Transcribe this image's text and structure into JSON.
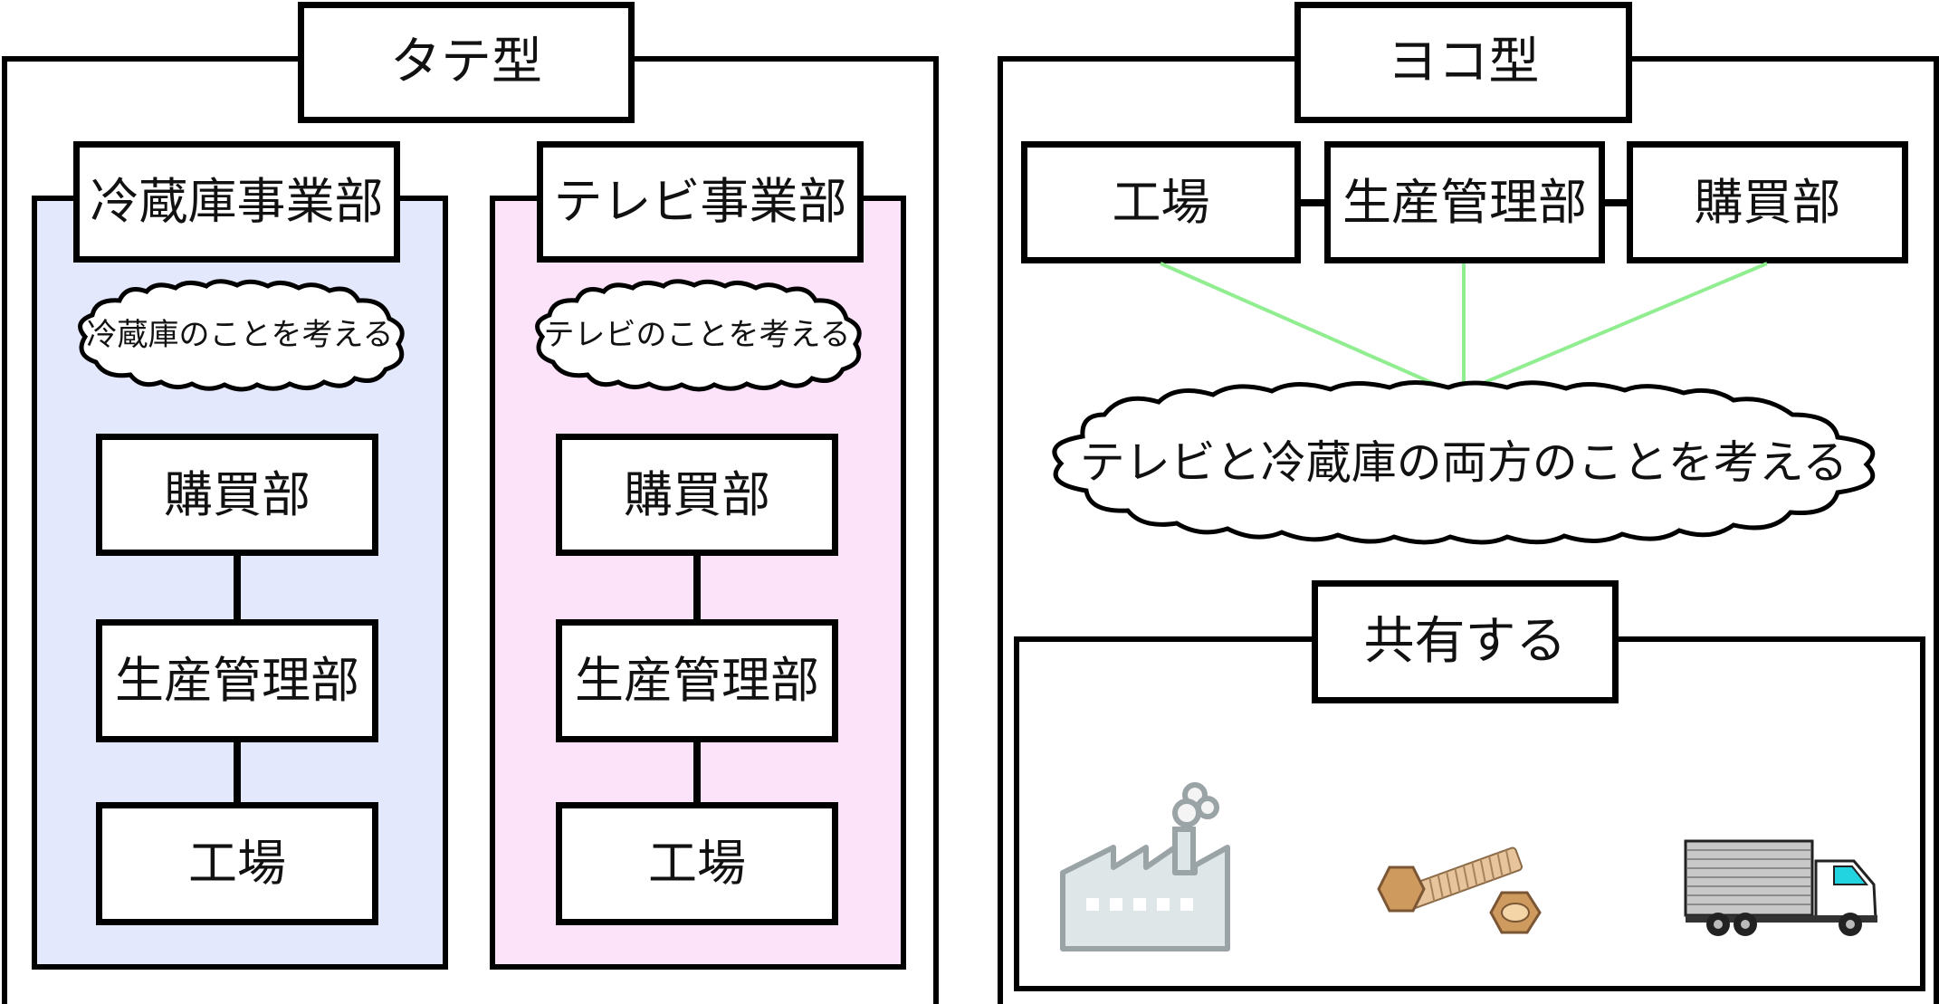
{
  "tate": {
    "title": "タテ型",
    "divisions": [
      {
        "name": "冷蔵庫事業部",
        "thought": "冷蔵庫のことを考える",
        "color": "#e3e8fc",
        "boxes": [
          "購買部",
          "生産管理部",
          "工場"
        ]
      },
      {
        "name": "テレビ事業部",
        "thought": "テレビのことを考える",
        "color": "#fde3fa",
        "boxes": [
          "購買部",
          "生産管理部",
          "工場"
        ]
      }
    ]
  },
  "yoko": {
    "title": "ヨコ型",
    "functions": [
      "工場",
      "生産管理部",
      "購買部"
    ],
    "thought": "テレビと冷蔵庫の両方のことを考える",
    "connector_color": "#90ee90",
    "shared": {
      "title": "共有する",
      "icons": [
        "factory-icon",
        "bolt-and-nut-icon",
        "truck-icon"
      ]
    }
  }
}
